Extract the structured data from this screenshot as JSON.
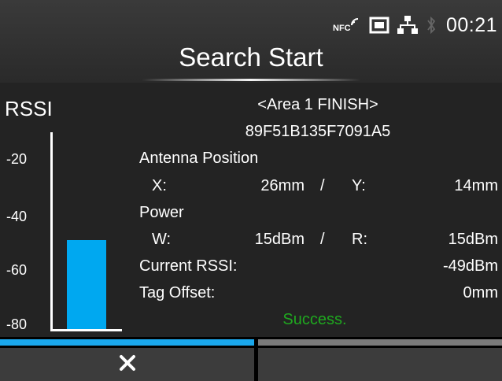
{
  "status": {
    "icons": [
      "nfc-icon",
      "sd-card-icon",
      "network-icon",
      "bluetooth-icon"
    ],
    "nfc_text": "NFC",
    "time": "00:21"
  },
  "header": {
    "title": "Search Start"
  },
  "chart": {
    "label": "RSSI",
    "ticks": [
      "-20",
      "-40",
      "-60",
      "-80"
    ],
    "value_dbm": -49,
    "range_dbm": [
      -85,
      -5
    ],
    "bar_color": "#00a8f0"
  },
  "info": {
    "area_status": "<Area 1 FINISH>",
    "tag_id": "89F51B135F7091A5",
    "antenna_position_label": "Antenna Position",
    "x_label": "X:",
    "x_value": "26mm",
    "separator": "/",
    "y_label": "Y:",
    "y_value": "14mm",
    "power_label": "Power",
    "w_label": "W:",
    "w_value": "15dBm",
    "r_label": "R:",
    "r_value": "15dBm",
    "current_rssi_label": "Current RSSI:",
    "current_rssi_value": "-49dBm",
    "tag_offset_label": "Tag Offset:",
    "tag_offset_value": "0mm",
    "result": "Success."
  },
  "progress": {
    "fraction": 0.506
  },
  "buttons": {
    "cancel_icon": "close-icon"
  },
  "colors": {
    "accent": "#1aa7ec",
    "success": "#1fa81f",
    "background": "#232323"
  }
}
